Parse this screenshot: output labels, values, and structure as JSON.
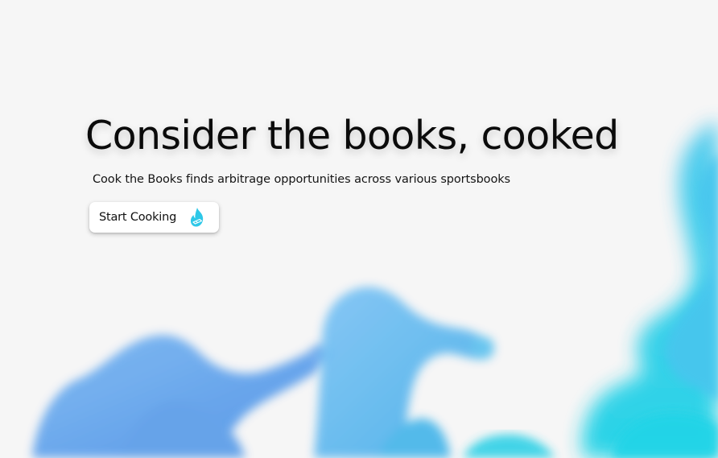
{
  "hero": {
    "title": "Consider the books, cooked",
    "subtitle": "Cook the Books finds arbitrage opportunities across various sportsbooks",
    "cta": {
      "label": "Start Cooking",
      "icon": "flame-icon"
    }
  },
  "colors": {
    "background": "#f6f6f6",
    "title_text": "#0b0b0b",
    "button_background": "#ffffff",
    "ink_blue": "#5aa8ef",
    "ink_cyan": "#33d6ea",
    "icon_color": "#2ec8e8"
  },
  "decoration": {
    "background_art": "blue-cyan-ink-smoke"
  }
}
